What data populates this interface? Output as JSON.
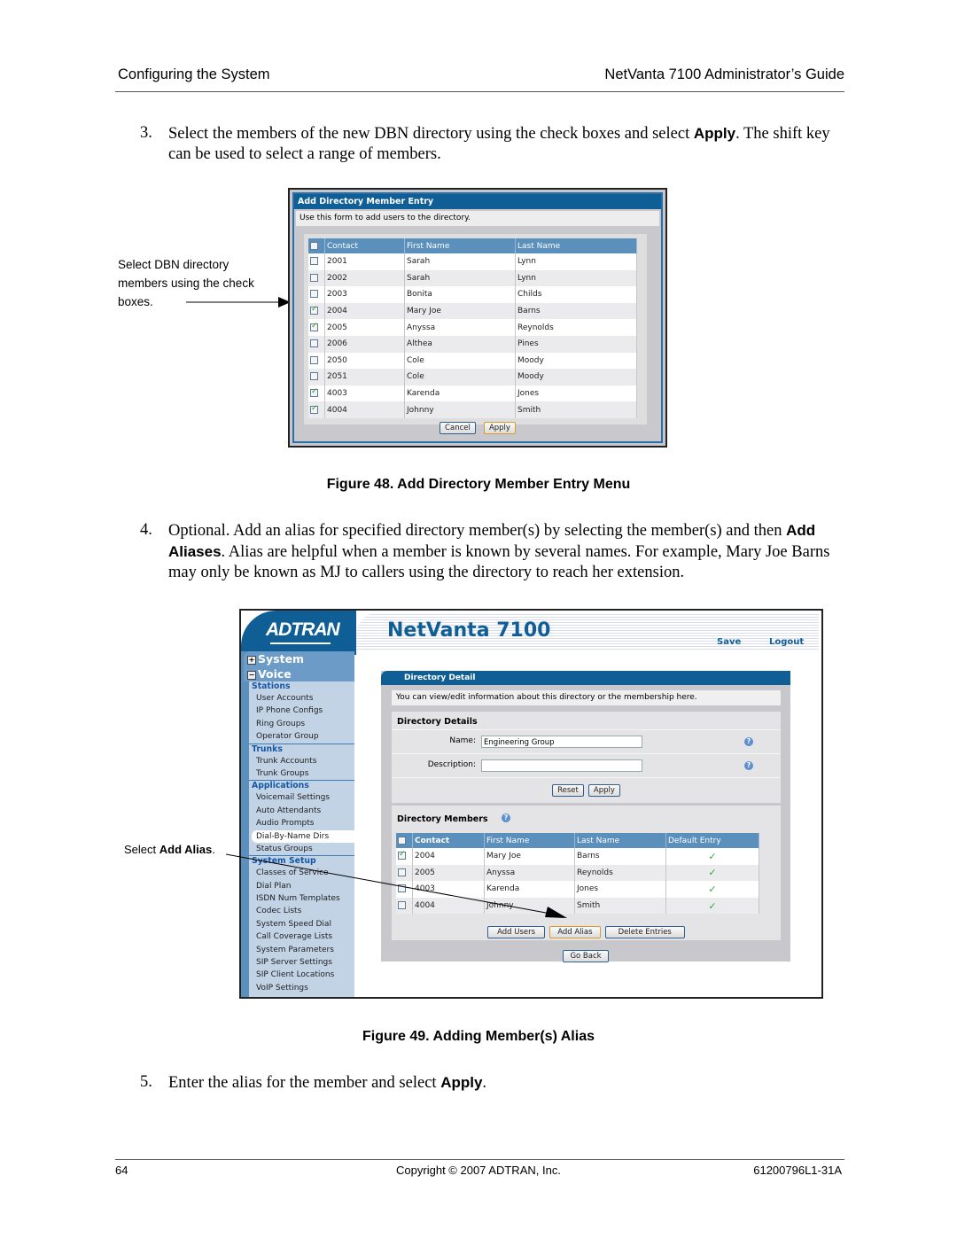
{
  "header": {
    "section": "Configuring the System",
    "guide": "NetVanta 7100 Administrator’s Guide"
  },
  "steps": [
    {
      "number": "3.",
      "text_before": "Select the members of the new DBN directory using the check boxes and select ",
      "bold": "Apply",
      "text_after": ". The shift key can be used to select a range of members."
    },
    {
      "number": "4.",
      "text_before": "Optional. Add an alias for specified directory member(s) by selecting the member(s) and then ",
      "bold": "Add Aliases",
      "text_after": ". Alias are helpful when a member is known by several names. For example, Mary Joe Barns may only be known as MJ to callers using the directory to reach her extension."
    },
    {
      "number": "5.",
      "text_before": "Enter the alias for the member and select ",
      "bold": "Apply",
      "text_after": "."
    }
  ],
  "figure48": {
    "caption": "Figure 48.  Add Directory Member Entry Menu",
    "callout": "Select DBN directory members using the check boxes.",
    "panel_title": "Add Directory Member Entry",
    "description": "Use this form to add users to the directory.",
    "columns": [
      "Contact",
      "First Name",
      "Last Name"
    ],
    "rows": [
      {
        "contact": "2001",
        "first": "Sarah",
        "last": "Lynn",
        "checked": false
      },
      {
        "contact": "2002",
        "first": "Sarah",
        "last": "Lynn",
        "checked": false
      },
      {
        "contact": "2003",
        "first": "Bonita",
        "last": "Childs",
        "checked": false
      },
      {
        "contact": "2004",
        "first": "Mary Joe",
        "last": "Barns",
        "checked": true
      },
      {
        "contact": "2005",
        "first": "Anyssa",
        "last": "Reynolds",
        "checked": true
      },
      {
        "contact": "2006",
        "first": "Althea",
        "last": "Pines",
        "checked": false
      },
      {
        "contact": "2050",
        "first": "Cole",
        "last": "Moody",
        "checked": false
      },
      {
        "contact": "2051",
        "first": "Cole",
        "last": "Moody",
        "checked": false
      },
      {
        "contact": "4003",
        "first": "Karenda",
        "last": "Jones",
        "checked": true
      },
      {
        "contact": "4004",
        "first": "Johnny",
        "last": "Smith",
        "checked": true
      }
    ],
    "buttons": {
      "cancel": "Cancel",
      "apply": "Apply"
    }
  },
  "figure49": {
    "caption": "Figure 49.  Adding Member(s) Alias",
    "callout_prefix": "Select ",
    "callout_bold": "Add Alias",
    "callout_suffix": ".",
    "logo": "ADTRAN",
    "product": "NetVanta 7100",
    "top_links": {
      "save": "Save",
      "logout": "Logout"
    },
    "nav": {
      "system": "System",
      "voice": "Voice",
      "sections": [
        {
          "title": "Stations",
          "items": [
            "User Accounts",
            "IP Phone Configs",
            "Ring Groups",
            "Operator Group"
          ]
        },
        {
          "title": "Trunks",
          "items": [
            "Trunk Accounts",
            "Trunk Groups"
          ]
        },
        {
          "title": "Applications",
          "items": [
            "Voicemail Settings",
            "Auto Attendants",
            "Audio Prompts",
            "Dial-By-Name Dirs",
            "Status Groups"
          ]
        },
        {
          "title": "System Setup",
          "items": [
            "Classes of Service",
            "Dial Plan",
            "ISDN Num Templates",
            "Codec Lists",
            "System Speed Dial",
            "Call Coverage Lists",
            "System Parameters",
            "SIP Server Settings",
            "SIP Client Locations",
            "VoIP Settings"
          ]
        }
      ],
      "selected": "Dial-By-Name Dirs"
    },
    "main_title": "Directory Detail",
    "info": "You can view/edit information about this directory or the membership here.",
    "details": {
      "title": "Directory Details",
      "name_label": "Name:",
      "name_value": "Engineering Group",
      "description_label": "Description:",
      "description_value": "",
      "reset": "Reset",
      "apply": "Apply"
    },
    "members": {
      "title": "Directory Members",
      "columns": [
        "Contact",
        "First Name",
        "Last Name",
        "Default Entry"
      ],
      "rows": [
        {
          "contact": "2004",
          "first": "Mary Joe",
          "last": "Barns",
          "default": true,
          "checked": true
        },
        {
          "contact": "2005",
          "first": "Anyssa",
          "last": "Reynolds",
          "default": true,
          "checked": false
        },
        {
          "contact": "4003",
          "first": "Karenda",
          "last": "Jones",
          "default": true,
          "checked": false
        },
        {
          "contact": "4004",
          "first": "Johnny",
          "last": "Smith",
          "default": true,
          "checked": false
        }
      ],
      "buttons": {
        "add_users": "Add Users",
        "add_alias": "Add Alias",
        "delete_entries": "Delete Entries"
      },
      "go_back": "Go Back"
    }
  },
  "footer": {
    "page": "64",
    "copyright": "Copyright © 2007 ADTRAN, Inc.",
    "doc_number": "61200796L1-31A"
  }
}
